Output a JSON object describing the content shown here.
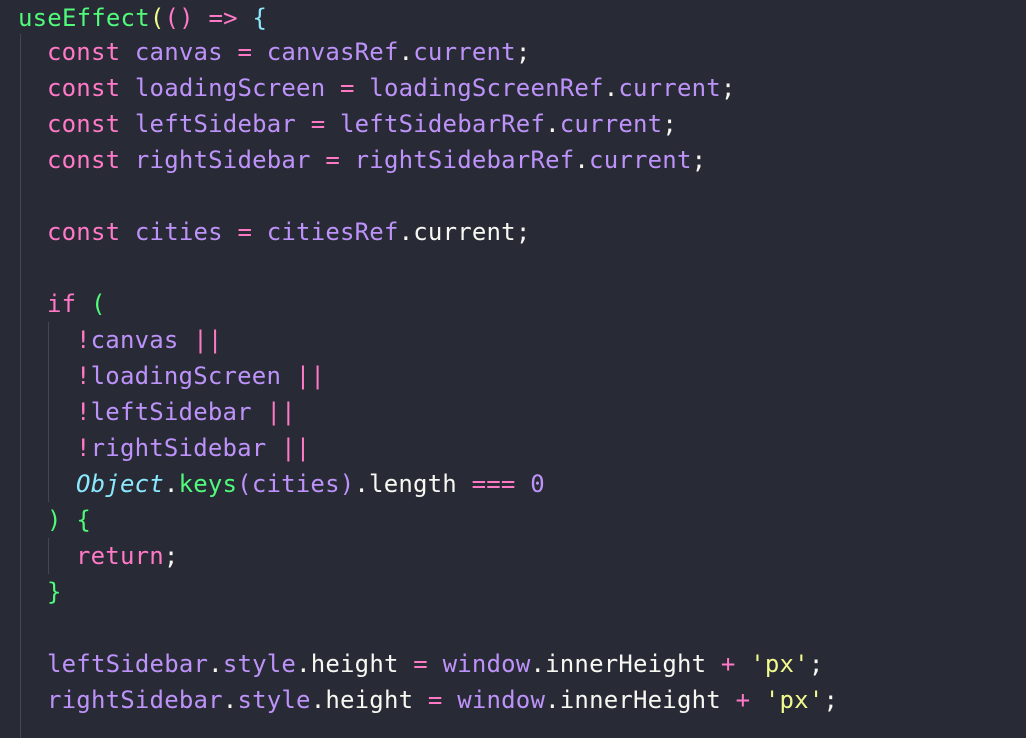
{
  "editor": {
    "lines": [
      {
        "tokens": [
          {
            "t": "useEffect",
            "c": "fn"
          },
          {
            "t": "(",
            "c": "brace-y"
          },
          {
            "t": "()",
            "c": "brace-p"
          },
          {
            "t": " ",
            "c": "plain"
          },
          {
            "t": "=>",
            "c": "op"
          },
          {
            "t": " ",
            "c": "plain"
          },
          {
            "t": "{",
            "c": "brace-b"
          }
        ]
      },
      {
        "tokens": [
          {
            "t": "const",
            "c": "kw"
          },
          {
            "t": " canvas ",
            "c": "var"
          },
          {
            "t": "=",
            "c": "op"
          },
          {
            "t": " canvasRef",
            "c": "var"
          },
          {
            "t": ".",
            "c": "plain"
          },
          {
            "t": "current",
            "c": "prop"
          },
          {
            "t": ";",
            "c": "plain"
          }
        ]
      },
      {
        "tokens": [
          {
            "t": "const",
            "c": "kw"
          },
          {
            "t": " loadingScreen ",
            "c": "var"
          },
          {
            "t": "=",
            "c": "op"
          },
          {
            "t": " loadingScreenRef",
            "c": "var"
          },
          {
            "t": ".",
            "c": "plain"
          },
          {
            "t": "current",
            "c": "prop"
          },
          {
            "t": ";",
            "c": "plain"
          }
        ]
      },
      {
        "tokens": [
          {
            "t": "const",
            "c": "kw"
          },
          {
            "t": " leftSidebar ",
            "c": "var"
          },
          {
            "t": "=",
            "c": "op"
          },
          {
            "t": " leftSidebarRef",
            "c": "var"
          },
          {
            "t": ".",
            "c": "plain"
          },
          {
            "t": "current",
            "c": "prop"
          },
          {
            "t": ";",
            "c": "plain"
          }
        ]
      },
      {
        "tokens": [
          {
            "t": "const",
            "c": "kw"
          },
          {
            "t": " rightSidebar ",
            "c": "var"
          },
          {
            "t": "=",
            "c": "op"
          },
          {
            "t": " rightSidebarRef",
            "c": "var"
          },
          {
            "t": ".",
            "c": "plain"
          },
          {
            "t": "current",
            "c": "prop"
          },
          {
            "t": ";",
            "c": "plain"
          }
        ]
      },
      {
        "tokens": []
      },
      {
        "tokens": [
          {
            "t": "const",
            "c": "kw"
          },
          {
            "t": " cities ",
            "c": "var"
          },
          {
            "t": "=",
            "c": "op"
          },
          {
            "t": " citiesRef",
            "c": "var"
          },
          {
            "t": ".",
            "c": "plain"
          },
          {
            "t": "current",
            "c": "plain"
          },
          {
            "t": ";",
            "c": "plain"
          }
        ]
      },
      {
        "tokens": []
      },
      {
        "tokens": [
          {
            "t": "if",
            "c": "kw"
          },
          {
            "t": " ",
            "c": "plain"
          },
          {
            "t": "(",
            "c": "brace-g"
          }
        ]
      },
      {
        "tokens": [
          {
            "t": "!",
            "c": "op"
          },
          {
            "t": "canvas ",
            "c": "var"
          },
          {
            "t": "||",
            "c": "op"
          }
        ]
      },
      {
        "tokens": [
          {
            "t": "!",
            "c": "op"
          },
          {
            "t": "loadingScreen ",
            "c": "var"
          },
          {
            "t": "||",
            "c": "op"
          }
        ]
      },
      {
        "tokens": [
          {
            "t": "!",
            "c": "op"
          },
          {
            "t": "leftSidebar ",
            "c": "var"
          },
          {
            "t": "||",
            "c": "op"
          }
        ]
      },
      {
        "tokens": [
          {
            "t": "!",
            "c": "op"
          },
          {
            "t": "rightSidebar ",
            "c": "var"
          },
          {
            "t": "||",
            "c": "op"
          }
        ]
      },
      {
        "tokens": [
          {
            "t": "Object",
            "c": "cls"
          },
          {
            "t": ".",
            "c": "plain"
          },
          {
            "t": "keys",
            "c": "fn"
          },
          {
            "t": "(",
            "c": "prop"
          },
          {
            "t": "cities",
            "c": "var"
          },
          {
            "t": ")",
            "c": "prop"
          },
          {
            "t": ".",
            "c": "plain"
          },
          {
            "t": "length ",
            "c": "plain"
          },
          {
            "t": "===",
            "c": "op"
          },
          {
            "t": " 0",
            "c": "num"
          }
        ]
      },
      {
        "tokens": [
          {
            "t": ")",
            "c": "brace-g"
          },
          {
            "t": " ",
            "c": "plain"
          },
          {
            "t": "{",
            "c": "brace-g"
          }
        ]
      },
      {
        "tokens": [
          {
            "t": "return",
            "c": "kw"
          },
          {
            "t": ";",
            "c": "plain"
          }
        ]
      },
      {
        "tokens": [
          {
            "t": "}",
            "c": "brace-g"
          }
        ]
      },
      {
        "tokens": []
      },
      {
        "tokens": [
          {
            "t": "leftSidebar",
            "c": "var"
          },
          {
            "t": ".",
            "c": "plain"
          },
          {
            "t": "style",
            "c": "prop"
          },
          {
            "t": ".",
            "c": "plain"
          },
          {
            "t": "height ",
            "c": "plain"
          },
          {
            "t": "=",
            "c": "op"
          },
          {
            "t": " window",
            "c": "var"
          },
          {
            "t": ".",
            "c": "plain"
          },
          {
            "t": "innerHeight ",
            "c": "plain"
          },
          {
            "t": "+",
            "c": "op"
          },
          {
            "t": " ",
            "c": "plain"
          },
          {
            "t": "'px'",
            "c": "str"
          },
          {
            "t": ";",
            "c": "plain"
          }
        ]
      },
      {
        "tokens": [
          {
            "t": "rightSidebar",
            "c": "var"
          },
          {
            "t": ".",
            "c": "plain"
          },
          {
            "t": "style",
            "c": "prop"
          },
          {
            "t": ".",
            "c": "plain"
          },
          {
            "t": "height ",
            "c": "plain"
          },
          {
            "t": "=",
            "c": "op"
          },
          {
            "t": " window",
            "c": "var"
          },
          {
            "t": ".",
            "c": "plain"
          },
          {
            "t": "innerHeight ",
            "c": "plain"
          },
          {
            "t": "+",
            "c": "op"
          },
          {
            "t": " ",
            "c": "plain"
          },
          {
            "t": "'px'",
            "c": "str"
          },
          {
            "t": ";",
            "c": "plain"
          }
        ]
      }
    ]
  },
  "colors": {
    "background": "#282a36",
    "keyword": "#ff79c6",
    "function": "#50fa7b",
    "variable": "#bd93f9",
    "string": "#f1fa8c",
    "class": "#8be9fd",
    "plain": "#f8f8f2",
    "indent_guide": "#44475a"
  }
}
